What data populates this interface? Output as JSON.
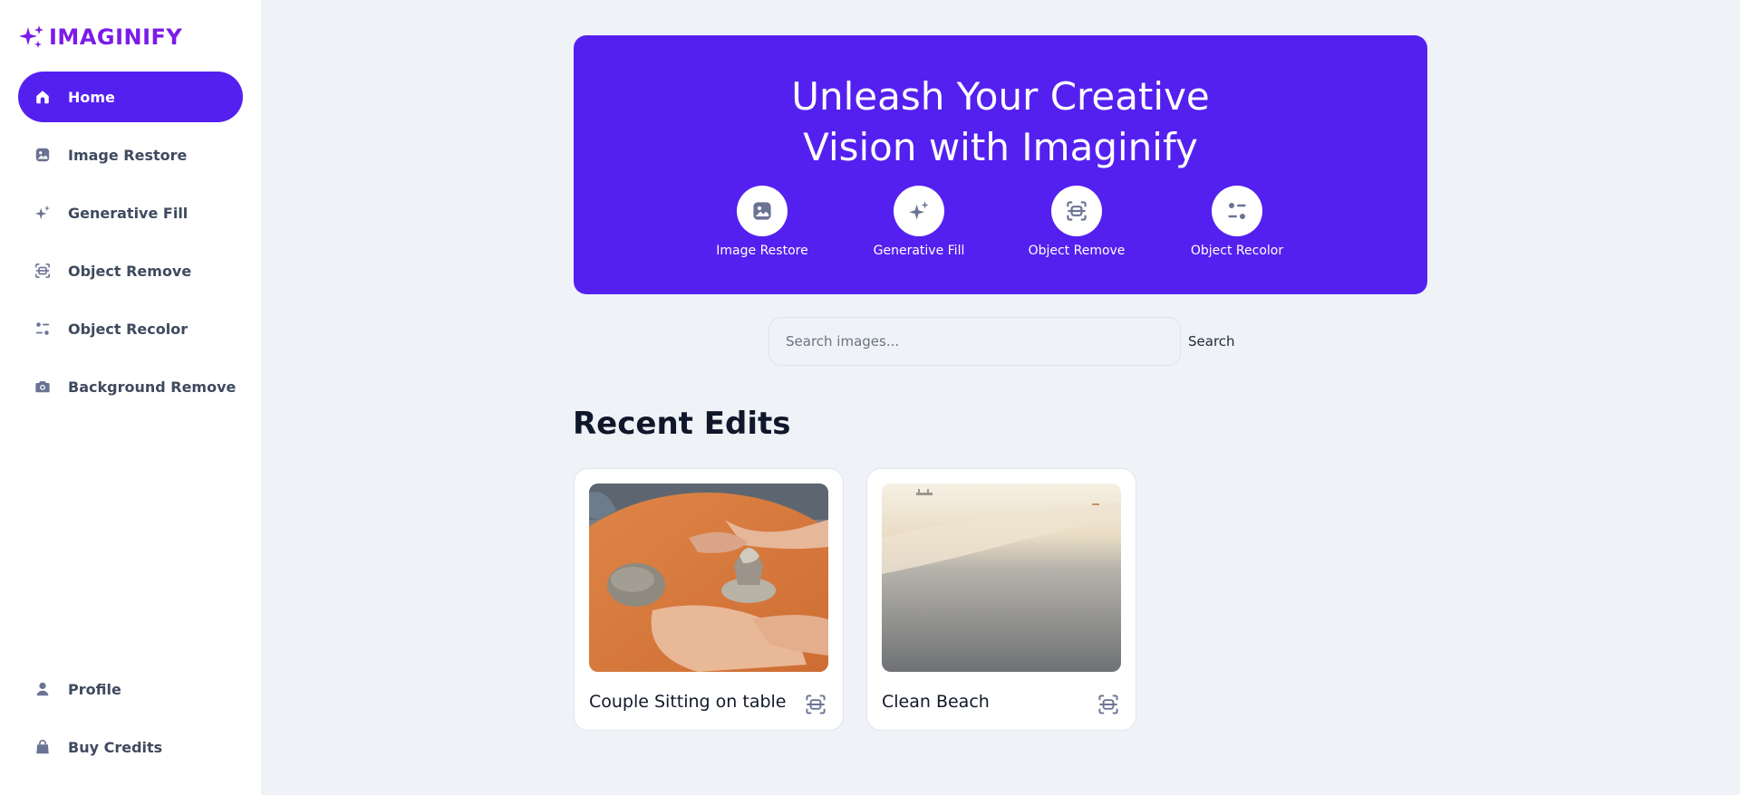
{
  "app": {
    "name": "IMAGINIFY",
    "brand_color": "#7b1be8",
    "accent_color": "#5420f0"
  },
  "sidebar": {
    "items": [
      {
        "label": "Home",
        "icon": "home-icon",
        "active": true
      },
      {
        "label": "Image Restore",
        "icon": "image-icon"
      },
      {
        "label": "Generative Fill",
        "icon": "stars-icon"
      },
      {
        "label": "Object Remove",
        "icon": "scan-icon"
      },
      {
        "label": "Object Recolor",
        "icon": "filter-icon"
      },
      {
        "label": "Background Remove",
        "icon": "camera-icon"
      }
    ],
    "bottom_items": [
      {
        "label": "Profile",
        "icon": "profile-icon"
      },
      {
        "label": "Buy Credits",
        "icon": "bag-icon"
      }
    ]
  },
  "hero": {
    "title_line1": "Unleash Your Creative",
    "title_line2": "Vision with Imaginify",
    "tools": [
      {
        "label": "Image Restore",
        "icon": "image-icon"
      },
      {
        "label": "Generative Fill",
        "icon": "stars-icon"
      },
      {
        "label": "Object Remove",
        "icon": "scan-icon"
      },
      {
        "label": "Object Recolor",
        "icon": "filter-icon"
      }
    ]
  },
  "search": {
    "placeholder": "Search images...",
    "value": "",
    "button_label": "Search"
  },
  "recent": {
    "title": "Recent Edits",
    "cards": [
      {
        "title": "Couple Sitting on table",
        "icon": "scan-icon"
      },
      {
        "title": "Clean Beach",
        "icon": "scan-icon"
      }
    ]
  }
}
